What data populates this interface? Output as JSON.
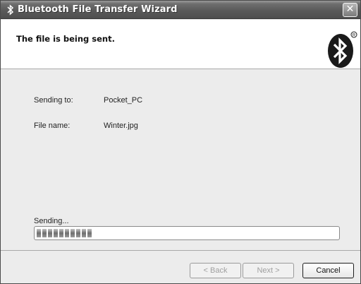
{
  "window": {
    "title": "Bluetooth File Transfer Wizard",
    "close_glyph": "✕"
  },
  "header": {
    "heading": "The file is being sent.",
    "logo_icon": "bluetooth-logo-icon"
  },
  "details": {
    "sending_to_label": "Sending to:",
    "sending_to_value": "Pocket_PC",
    "file_name_label": "File name:",
    "file_name_value": "Winter.jpg"
  },
  "progress": {
    "label": "Sending...",
    "fraction": 0.18
  },
  "buttons": {
    "back": "< Back",
    "next": "Next >",
    "cancel": "Cancel"
  }
}
